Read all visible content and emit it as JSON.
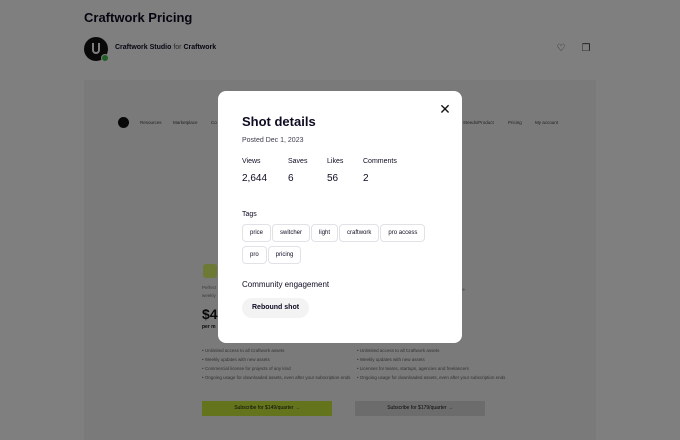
{
  "page": {
    "title": "Craftwork Pricing",
    "owner": {
      "name": "Craftwork Studio",
      "for": "for",
      "team": "Craftwork"
    }
  },
  "shot_preview": {
    "nav": [
      "Resources",
      "Marketplace",
      "Co",
      "Steeds/Product",
      "Pricing",
      "My account"
    ],
    "left_plan": {
      "desc_1": "Perfect",
      "desc_2": "weekly",
      "price": "$4",
      "per": "per m",
      "features": [
        "Unlimited access to all Craftwork assets",
        "Weekly updates with new assets",
        "Commercial license for projects of any kind",
        "Ongoing usage for downloaded assets, even after your subscription ends"
      ],
      "cta": "Subscribe for $149/quarter →"
    },
    "right_plan": {
      "desc": "fe",
      "features": [
        "Unlimited access to all Craftwork assets",
        "Weekly updates with new assets",
        "Licenses for teams, startups, agencies and freelancers",
        "Ongoing usage for downloaded assets, even after your subscription ends"
      ],
      "cta": "Subscribe for $179/quarter →"
    }
  },
  "modal": {
    "title": "Shot details",
    "posted": "Posted Dec 1, 2023",
    "stats": [
      {
        "label": "Views",
        "value": "2,644"
      },
      {
        "label": "Saves",
        "value": "6"
      },
      {
        "label": "Likes",
        "value": "56"
      },
      {
        "label": "Comments",
        "value": "2"
      }
    ],
    "tags_label": "Tags",
    "tags": [
      "price",
      "switcher",
      "light",
      "craftwork",
      "pro access",
      "pro",
      "pricing"
    ],
    "community_label": "Community engagement",
    "rebound_label": "Rebound shot",
    "close_glyph": "✕"
  },
  "icons": {
    "heart": "♡",
    "bookmark": "❐"
  },
  "colors": {
    "accent_lime": "#c7e83a",
    "badge_green": "#3ebd49",
    "text_primary": "#0d0c22",
    "overlay": "rgba(0,0,0,0.5)"
  }
}
